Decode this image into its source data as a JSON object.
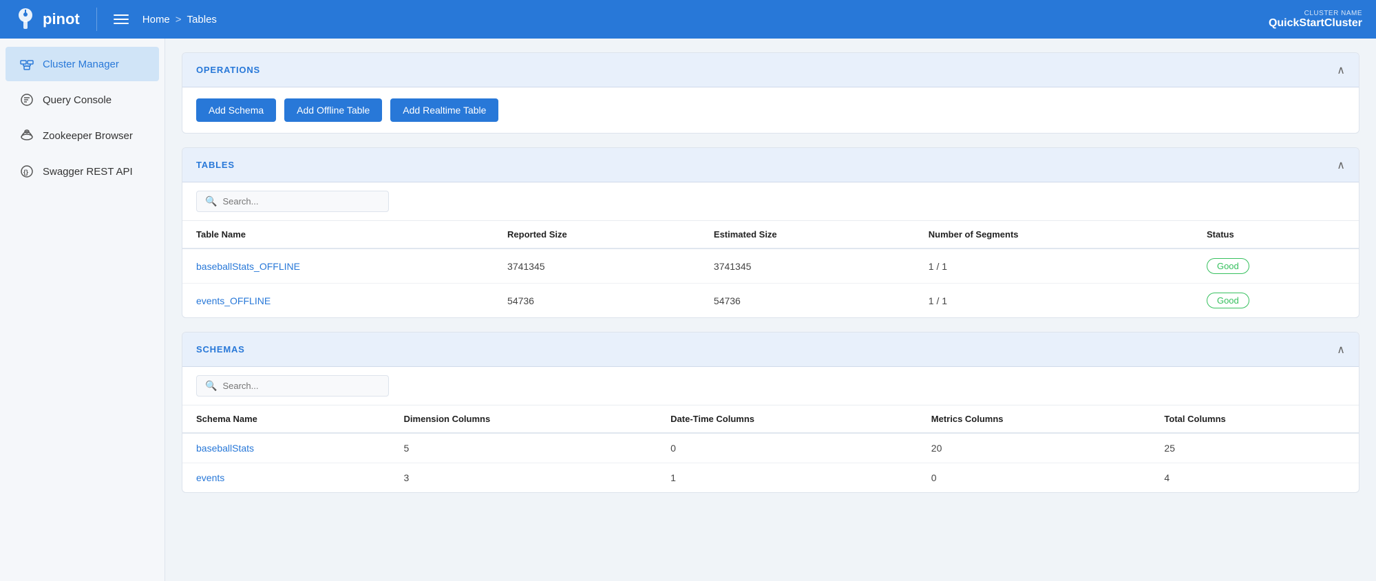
{
  "header": {
    "logo_text": "pinot",
    "menu_icon": "menu",
    "breadcrumb": {
      "home": "Home",
      "separator": ">",
      "current": "Tables"
    },
    "cluster": {
      "label": "CLUSTER NAME",
      "name": "QuickStartCluster"
    }
  },
  "sidebar": {
    "items": [
      {
        "id": "cluster-manager",
        "label": "Cluster Manager",
        "icon": "cluster-icon",
        "active": true
      },
      {
        "id": "query-console",
        "label": "Query Console",
        "icon": "query-icon",
        "active": false
      },
      {
        "id": "zookeeper-browser",
        "label": "Zookeeper Browser",
        "icon": "zookeeper-icon",
        "active": false
      },
      {
        "id": "swagger-rest-api",
        "label": "Swagger REST API",
        "icon": "swagger-icon",
        "active": false
      }
    ]
  },
  "operations": {
    "section_title": "OPERATIONS",
    "buttons": [
      {
        "id": "add-schema",
        "label": "Add Schema"
      },
      {
        "id": "add-offline-table",
        "label": "Add Offline Table"
      },
      {
        "id": "add-realtime-table",
        "label": "Add Realtime Table"
      }
    ]
  },
  "tables": {
    "section_title": "TABLES",
    "search_placeholder": "Search...",
    "columns": [
      "Table Name",
      "Reported Size",
      "Estimated Size",
      "Number of Segments",
      "Status"
    ],
    "rows": [
      {
        "name": "baseballStats_OFFLINE",
        "reported_size": "3741345",
        "estimated_size": "3741345",
        "segments": "1 / 1",
        "status": "Good"
      },
      {
        "name": "events_OFFLINE",
        "reported_size": "54736",
        "estimated_size": "54736",
        "segments": "1 / 1",
        "status": "Good"
      }
    ]
  },
  "schemas": {
    "section_title": "SCHEMAS",
    "search_placeholder": "Search...",
    "columns": [
      "Schema Name",
      "Dimension Columns",
      "Date-Time Columns",
      "Metrics Columns",
      "Total Columns"
    ],
    "rows": [
      {
        "name": "baseballStats",
        "dimension": "5",
        "datetime": "0",
        "metrics": "20",
        "total": "25"
      },
      {
        "name": "events",
        "dimension": "3",
        "datetime": "1",
        "metrics": "0",
        "total": "4"
      }
    ]
  }
}
